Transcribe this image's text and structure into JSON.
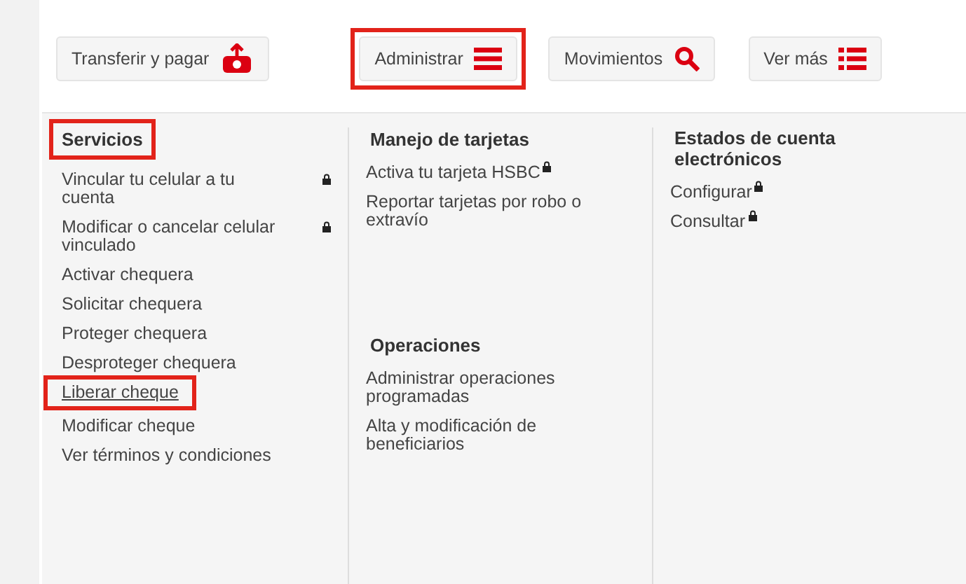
{
  "nav_buttons": [
    {
      "label": "Transferir y pagar",
      "highlighted": false
    },
    {
      "label": "Administrar",
      "highlighted": true
    },
    {
      "label": "Movimientos",
      "highlighted": false
    },
    {
      "label": "Ver más",
      "highlighted": false
    }
  ],
  "menu": {
    "columns": [
      {
        "sections": [
          {
            "heading": "Servicios",
            "highlighted": true,
            "items": [
              {
                "label": "Vincular tu celular a tu cuenta",
                "locked": true,
                "highlighted": false
              },
              {
                "label": "Modificar o cancelar celular vinculado",
                "locked": true,
                "highlighted": false
              },
              {
                "label": "Activar chequera",
                "locked": false,
                "highlighted": false
              },
              {
                "label": "Solicitar chequera",
                "locked": false,
                "highlighted": false
              },
              {
                "label": "Proteger chequera",
                "locked": false,
                "highlighted": false
              },
              {
                "label": "Desproteger chequera",
                "locked": false,
                "highlighted": false
              },
              {
                "label": "Liberar cheque",
                "locked": false,
                "highlighted": true
              },
              {
                "label": "Modificar cheque",
                "locked": false,
                "highlighted": false
              },
              {
                "label": "Ver términos y condiciones",
                "locked": false,
                "highlighted": false
              }
            ]
          }
        ]
      },
      {
        "sections": [
          {
            "heading": "Manejo de tarjetas",
            "highlighted": false,
            "items": [
              {
                "label": "Activa tu tarjeta HSBC",
                "locked": true,
                "highlighted": false
              },
              {
                "label": "Reportar tarjetas por robo o extravío",
                "locked": false,
                "highlighted": false
              }
            ]
          },
          {
            "heading": "Operaciones",
            "highlighted": false,
            "items": [
              {
                "label": "Administrar operaciones programadas",
                "locked": false,
                "highlighted": false
              },
              {
                "label": "Alta y modificación de beneficiarios",
                "locked": false,
                "highlighted": false
              }
            ]
          }
        ]
      },
      {
        "sections": [
          {
            "heading": "Estados de cuenta electrónicos",
            "highlighted": false,
            "items": [
              {
                "label": "Configurar",
                "locked": true,
                "highlighted": false
              },
              {
                "label": "Consultar",
                "locked": true,
                "highlighted": false
              }
            ]
          }
        ]
      }
    ]
  }
}
